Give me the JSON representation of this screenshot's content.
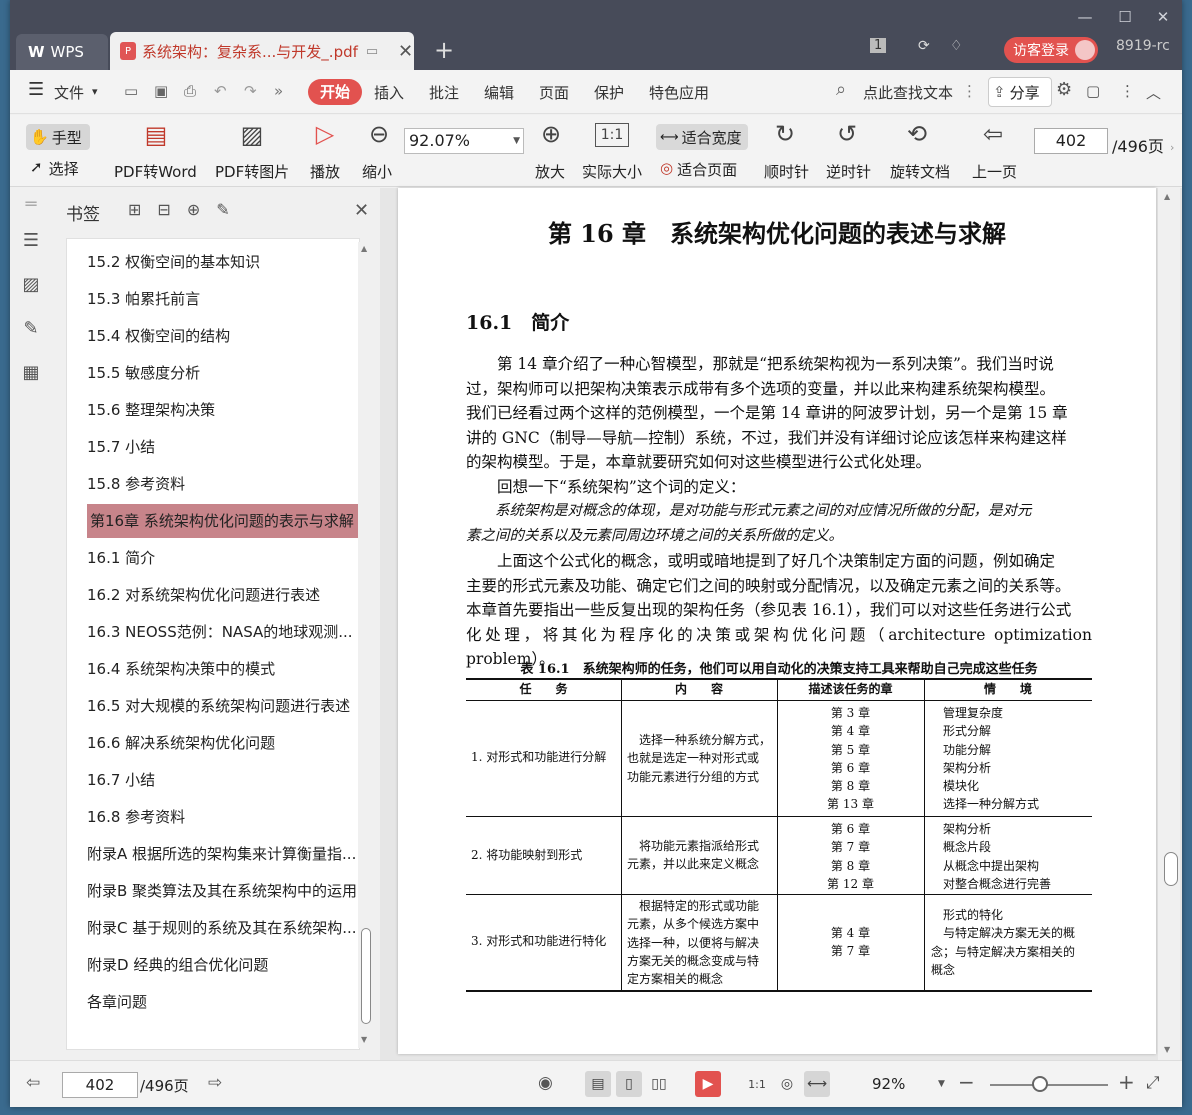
{
  "window": {
    "minimize": "—",
    "maximize": "☐",
    "close": "✕"
  },
  "tabs": {
    "wps": "WPS",
    "doc_title": "系统架构：复杂系...与开发_.pdf",
    "close": "✕",
    "add": "+"
  },
  "titlebar_right": {
    "badge": "1",
    "login": "访客登录",
    "user": "8919-rc"
  },
  "menu": {
    "file": "文件",
    "start": "开始",
    "insert": "插入",
    "annotate": "批注",
    "edit": "编辑",
    "page": "页面",
    "protect": "保护",
    "special": "特色应用",
    "search": "点此查找文本",
    "share": "分享"
  },
  "toolbar": {
    "hand": "手型",
    "select": "选择",
    "pdf2word": "PDF转Word",
    "pdf2img": "PDF转图片",
    "play": "播放",
    "zoom_out": "缩小",
    "zoom_value": "92.07%",
    "zoom_in": "放大",
    "actual": "实际大小",
    "fit_width": "适合宽度",
    "fit_page": "适合页面",
    "cw": "顺时针",
    "ccw": "逆时针",
    "rotate": "旋转文档",
    "prev": "上一页",
    "page_current": "402",
    "page_total": "/496页"
  },
  "bookmarks": {
    "title": "书签",
    "items": [
      "15.2 权衡空间的基本知识",
      "15.3 帕累托前言",
      "15.4 权衡空间的结构",
      "15.5 敏感度分析",
      "15.6 整理架构决策",
      "15.7 小结",
      "15.8 参考资料",
      "第16章 系统架构优化问题的表示与求解",
      "16.1 简介",
      "16.2 对系统架构优化问题进行表述",
      "16.3 NEOSS范例：NASA的地球观测...",
      "16.4 系统架构决策中的模式",
      "16.5 对大规模的系统架构问题进行表述",
      "16.6 解决系统架构优化问题",
      "16.7 小结",
      "16.8 参考资料",
      "附录A 根据所选的架构集来计算衡量指...",
      "附录B 聚类算法及其在系统架构中的运用",
      "附录C 基于规则的系统及其在系统架构...",
      "附录D 经典的组合优化问题",
      "各章问题"
    ],
    "selected_index": 7
  },
  "doc": {
    "chapter_title": "第 16 章　系统架构优化问题的表述与求解",
    "section_title": "16.1　简介",
    "p1": [
      "　　第 14 章介绍了一种心智模型，那就是“把系统架构视为一系列决策”。我们当时说",
      "过，架构师可以把架构决策表示成带有多个选项的变量，并以此来构建系统架构模型。",
      "我们已经看过两个这样的范例模型，一个是第 14 章讲的阿波罗计划，另一个是第 15 章",
      "讲的 GNC（制导—导航—控制）系统，不过，我们并没有详细讨论应该怎样来构建这样",
      "的架构模型。于是，本章就要研究如何对这些模型进行公式化处理。"
    ],
    "p2": "　　回想一下“系统架构”这个词的定义：",
    "def": [
      "　　系统架构是对概念的体现，是对功能与形式元素之间的对应情况所做的分配，是对元",
      "素之间的关系以及元素同周边环境之间的关系所做的定义。"
    ],
    "p3": [
      "　　上面这个公式化的概念，或明或暗地提到了好几个决策制定方面的问题，例如确定",
      "主要的形式元素及功能、确定它们之间的映射或分配情况，以及确定元素之间的关系等。",
      "本章首先要指出一些反复出现的架构任务（参见表 16.1），我们可以对这些任务进行公式",
      "化处理，将其化为程序化的决策或架构优化问题（architecture optimization problem）。"
    ],
    "table_caption": "表 16.1　系统架构师的任务，他们可以用自动化的决策支持工具来帮助自己完成这些任务",
    "table_headers": [
      "任　　务",
      "内　　容",
      "描述该任务的章",
      "情　　境"
    ],
    "rows": [
      {
        "task": "1. 对形式和功能进行分解",
        "content": [
          "　选择一种系统分解方式，",
          "也就是选定一种对形式或",
          "功能元素进行分组的方式"
        ],
        "chapters": [
          "第 3 章",
          "第 4 章",
          "第 5 章",
          "第 6 章",
          "第 8 章",
          "第 13 章"
        ],
        "context": [
          "管理复杂度",
          "形式分解",
          "功能分解",
          "架构分析",
          "模块化",
          "选择一种分解方式"
        ]
      },
      {
        "task": "2. 将功能映射到形式",
        "content": [
          "　将功能元素指派给形式",
          "元素，并以此来定义概念"
        ],
        "chapters": [
          "第 6 章",
          "第 7 章",
          "第 8 章",
          "第 12 章"
        ],
        "context": [
          "架构分析",
          "概念片段",
          "从概念中提出架构",
          "对整合概念进行完善"
        ]
      },
      {
        "task": "3. 对形式和功能进行特化",
        "content": [
          "　根据特定的形式或功能",
          "元素，从多个候选方案中",
          "选择一种，以便将与解决",
          "方案无关的概念变成与特",
          "定方案相关的概念"
        ],
        "chapters": [
          "第 4 章",
          "第 7 章"
        ],
        "context": [
          "形式的特化",
          "　与特定解决方案无关的概",
          "念；与特定解决方案相关的",
          "概念"
        ]
      }
    ]
  },
  "statusbar": {
    "page_current": "402",
    "page_total": "/496页",
    "zoom": "92%"
  }
}
